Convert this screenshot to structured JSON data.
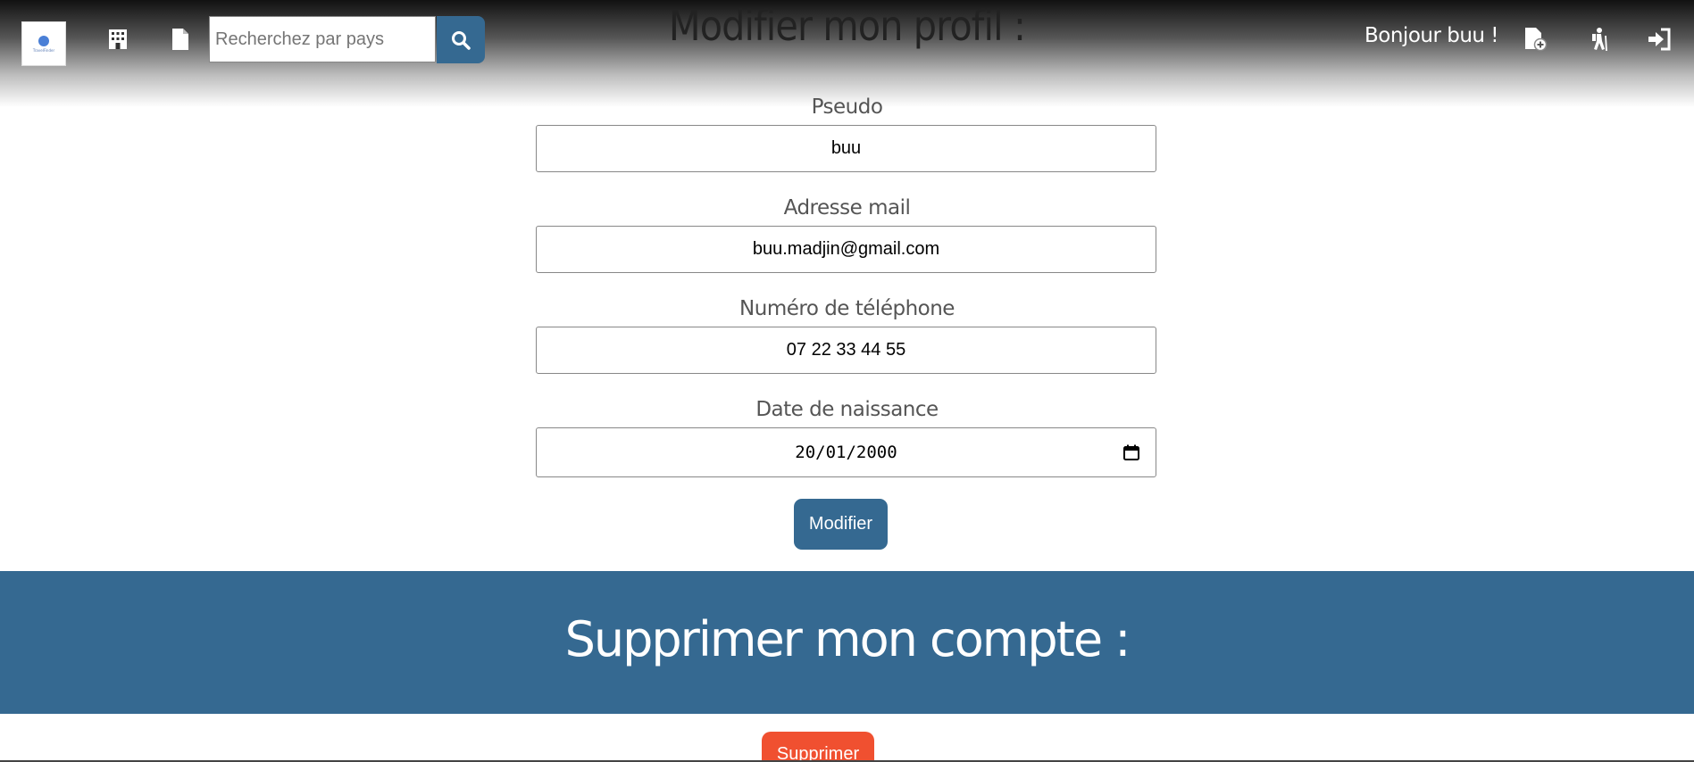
{
  "header": {
    "logo_text": "TravelFinder",
    "search_placeholder": "Recherchez par pays",
    "greeting": "Bonjour buu !",
    "icons": [
      "building-icon",
      "document-icon",
      "search-icon",
      "add-file-icon",
      "hiking-person-icon",
      "sign-in-icon"
    ]
  },
  "profile": {
    "title": "Modifier mon profil :",
    "pseudo_label": "Pseudo",
    "pseudo_value": "buu",
    "email_label": "Adresse mail",
    "email_value": "buu.madjin@gmail.com",
    "phone_label": "Numéro de téléphone",
    "phone_value": "07 22 33 44 55",
    "birthdate_label": "Date de naissance",
    "birthdate_value": "20/01/2000",
    "submit_label": "Modifier"
  },
  "delete_account": {
    "title": "Supprimer mon compte :",
    "button_label": "Supprimer"
  },
  "colors": {
    "primary": "#356991",
    "danger": "#f05030",
    "header_dark": "#111111"
  }
}
